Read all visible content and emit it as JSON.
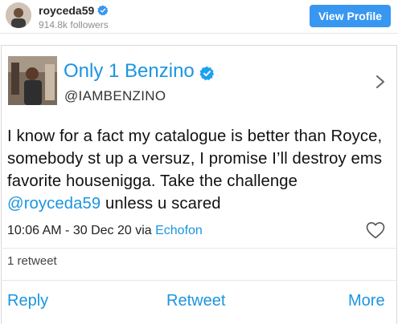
{
  "header": {
    "username": "royceda59",
    "followers": "914.8k followers",
    "view_profile_label": "View Profile"
  },
  "tweet": {
    "display_name": "Only 1 Benzino",
    "handle": "@IAMBENZINO",
    "text_before_mention": "I know for a fact my catalogue is better than Royce, somebody st up a versuz, I promise I’ll destroy ems favorite housenigga. Take the challenge ",
    "mention": "@royceda59",
    "text_after_mention": " unless u scared",
    "timestamp": "10:06 AM - 30 Dec 20 via ",
    "via_app": "Echofon",
    "retweet_count": "1 retweet"
  },
  "actions": {
    "reply": "Reply",
    "retweet": "Retweet",
    "more": "More"
  },
  "colors": {
    "link_blue": "#1b95e0",
    "button_blue": "#3897f0",
    "verified_blue": "#1da1f2",
    "ig_verified_blue": "#3897f0"
  },
  "icons": [
    "verified-badge-icon",
    "chevron-right-icon",
    "heart-icon"
  ]
}
